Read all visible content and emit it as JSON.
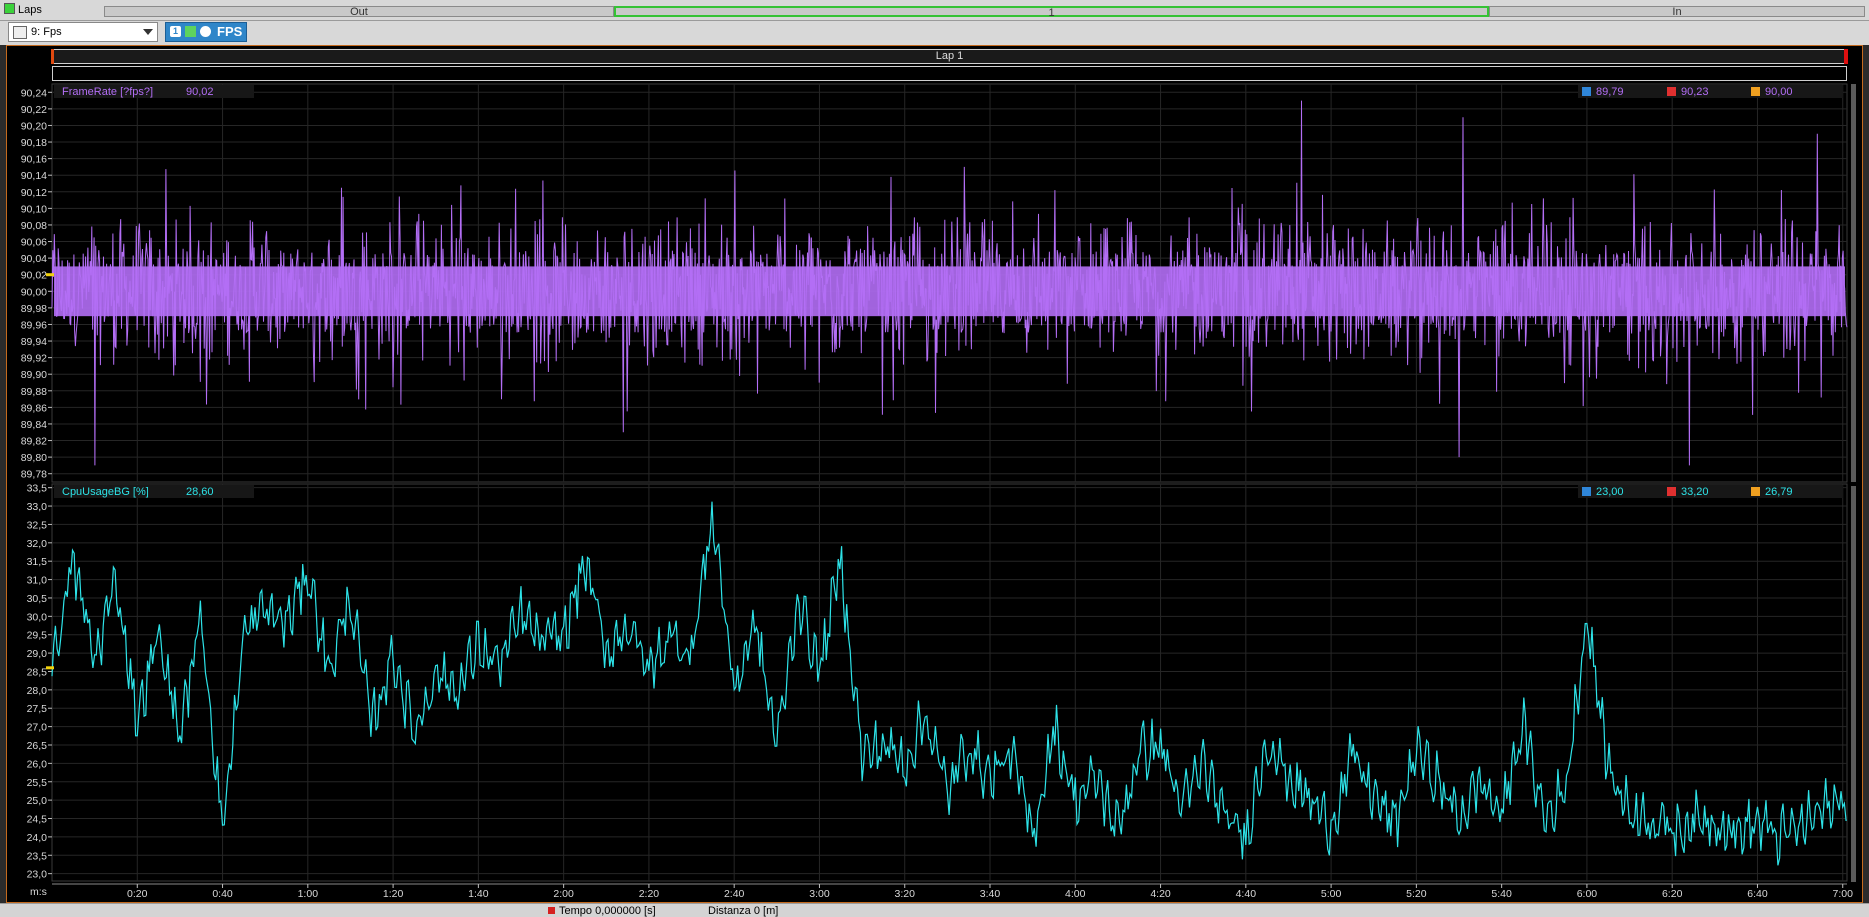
{
  "topbar": {
    "laps_label": "Laps",
    "segments": [
      "Out",
      "1",
      "In"
    ]
  },
  "toolbar": {
    "workbook_select": "9: Fps",
    "fps_button": "FPS",
    "fps_button_index": "1"
  },
  "lap_bar": {
    "label": "Lap 1"
  },
  "footer": {
    "time_label": "Tempo",
    "time_value": "0,000000 [s]",
    "distance_label": "Distanza",
    "distance_value": "0 [m]"
  },
  "chart_data": [
    {
      "type": "line",
      "series_name": "FrameRate [?fps?]",
      "cursor_value": "90,02",
      "stats": {
        "min": "89,79",
        "max": "90,23",
        "avg": "90,00"
      },
      "color": "#b36ef5",
      "ylim": [
        89.77,
        90.25
      ],
      "yticks": [
        "90,24",
        "90,22",
        "90,20",
        "90,18",
        "90,16",
        "90,14",
        "90,12",
        "90,10",
        "90,08",
        "90,06",
        "90,04",
        "90,02",
        "90,00",
        "89,98",
        "89,96",
        "89,94",
        "89,92",
        "89,90",
        "89,88",
        "89,86",
        "89,84",
        "89,82",
        "89,80",
        "89,78"
      ],
      "ytick_values": [
        90.24,
        90.22,
        90.2,
        90.18,
        90.16,
        90.14,
        90.12,
        90.1,
        90.08,
        90.06,
        90.04,
        90.02,
        90.0,
        89.98,
        89.96,
        89.94,
        89.92,
        89.9,
        89.88,
        89.86,
        89.84,
        89.82,
        89.8,
        89.78
      ],
      "y_mean": 90.0,
      "y_band_low": 89.97,
      "y_band_high": 90.03,
      "spikes": [
        {
          "t": 10,
          "v": 89.79
        },
        {
          "t": 134,
          "v": 89.83
        },
        {
          "t": 214,
          "v": 90.15
        },
        {
          "t": 293,
          "v": 90.23
        },
        {
          "t": 330,
          "v": 89.8
        },
        {
          "t": 331,
          "v": 90.21
        },
        {
          "t": 384,
          "v": 89.79
        },
        {
          "t": 414,
          "v": 90.19
        }
      ]
    },
    {
      "type": "line",
      "series_name": "CpuUsageBG [%]",
      "cursor_value": "28,60",
      "stats": {
        "min": "23,00",
        "max": "33,20",
        "avg": "26,79"
      },
      "color": "#2de3e8",
      "ylim": [
        22.8,
        33.6
      ],
      "yticks": [
        "33,5",
        "33,0",
        "32,5",
        "32,0",
        "31,5",
        "31,0",
        "30,5",
        "30,0",
        "29,5",
        "29,0",
        "28,5",
        "28,0",
        "27,5",
        "27,0",
        "26,5",
        "26,0",
        "25,5",
        "25,0",
        "24,5",
        "24,0",
        "23,5",
        "23,0"
      ],
      "ytick_values": [
        33.5,
        33.0,
        32.5,
        32.0,
        31.5,
        31.0,
        30.5,
        30.0,
        29.5,
        29.0,
        28.5,
        28.0,
        27.5,
        27.0,
        26.5,
        26.0,
        25.5,
        25.0,
        24.5,
        24.0,
        23.5,
        23.0
      ],
      "x": [
        0,
        5,
        10,
        15,
        20,
        25,
        30,
        35,
        40,
        45,
        50,
        55,
        60,
        65,
        70,
        75,
        80,
        85,
        90,
        95,
        100,
        105,
        110,
        115,
        120,
        125,
        130,
        135,
        140,
        145,
        150,
        155,
        160,
        165,
        170,
        175,
        180,
        185,
        190,
        195,
        200,
        205,
        210,
        215,
        220,
        225,
        230,
        235,
        240,
        245,
        250,
        255,
        260,
        265,
        270,
        275,
        280,
        285,
        290,
        295,
        300,
        305,
        310,
        315,
        320,
        325,
        330,
        335,
        340,
        345,
        350,
        355,
        360,
        365,
        370,
        375,
        380,
        385,
        390,
        395,
        400,
        405,
        410,
        415,
        420
      ],
      "y": [
        28.6,
        31.5,
        28.8,
        31.0,
        27.2,
        29.5,
        26.8,
        30.0,
        24.2,
        29.5,
        30.2,
        29.8,
        31.2,
        28.5,
        30.5,
        27.0,
        29.0,
        26.8,
        28.5,
        28.0,
        29.2,
        28.7,
        30.0,
        29.3,
        29.5,
        31.5,
        29.0,
        29.8,
        28.5,
        29.5,
        29.0,
        32.8,
        28.0,
        29.8,
        26.5,
        30.5,
        28.5,
        31.5,
        26.2,
        26.5,
        26.0,
        27.3,
        25.2,
        26.5,
        25.6,
        26.3,
        24.0,
        27.0,
        25.0,
        25.6,
        24.2,
        26.3,
        26.5,
        24.8,
        26.0,
        24.5,
        24.0,
        26.7,
        25.6,
        25.0,
        24.3,
        26.2,
        25.1,
        24.3,
        26.4,
        25.5,
        24.5,
        25.5,
        24.6,
        27.1,
        24.5,
        25.3,
        30.0,
        25.9,
        24.7,
        24.5,
        24.2,
        24.4,
        24.5,
        24.1,
        24.4,
        24.0,
        24.3,
        24.7,
        25.0
      ],
      "fine_noise_amplitude": 0.9
    }
  ],
  "x_axis": {
    "unit_label": "m:s",
    "tick_labels": [
      "0:20",
      "0:40",
      "1:00",
      "1:20",
      "1:40",
      "2:00",
      "2:20",
      "2:40",
      "3:00",
      "3:20",
      "3:40",
      "4:00",
      "4:20",
      "4:40",
      "5:00",
      "5:20",
      "5:40",
      "6:00",
      "6:20",
      "6:40",
      "7:00"
    ],
    "tick_values": [
      20,
      40,
      60,
      80,
      100,
      120,
      140,
      160,
      180,
      200,
      220,
      240,
      260,
      280,
      300,
      320,
      340,
      360,
      380,
      400,
      420
    ],
    "xlim": [
      0,
      421
    ]
  }
}
